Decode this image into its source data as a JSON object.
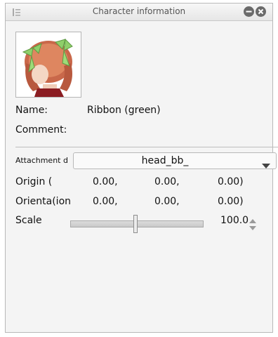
{
  "window": {
    "title": "Character information"
  },
  "fields": {
    "name_label": "Name:",
    "name_value": "Ribbon (green)",
    "comment_label": "Comment:",
    "comment_value": ""
  },
  "attachment": {
    "label": "Attachment d",
    "selected": "head_bb_"
  },
  "origin": {
    "label": "Origin (",
    "x": "0.00,",
    "y": "0.00,",
    "z": "0.00)"
  },
  "orientation": {
    "label": "Orienta(ion",
    "x": "0.00,",
    "y": "0.00,",
    "z": "0.00)"
  },
  "scale": {
    "label": "Scale",
    "value": "100.0",
    "slider_fraction": 0.49
  },
  "colors": {
    "panel_bg": "#f4f4f4",
    "ribbon_green": "#8fcf6a",
    "hair": "#c9684a"
  },
  "icons": {
    "grip": "panel-grip-icon",
    "minimize": "minimize-icon",
    "close": "close-icon",
    "dropdown": "chevron-down-icon",
    "spinner": "spinner-arrows-icon"
  }
}
